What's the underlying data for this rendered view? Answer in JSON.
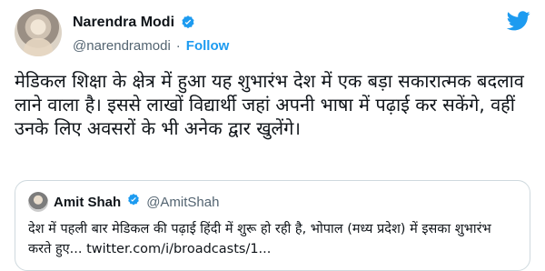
{
  "tweet": {
    "author_name": "Narendra Modi",
    "handle": "@narendramodi",
    "separator": "·",
    "follow_label": "Follow",
    "text": "मेडिकल शिक्षा के क्षेत्र में हुआ यह शुभारंभ देश में एक बड़ा सकारात्मक बदलाव लाने वाला है। इससे लाखों विद्यार्थी जहां अपनी भाषा में पढ़ाई कर सकेंगे, वहीं उनके लिए अवसरों के भी अनेक द्वार खुलेंगे।"
  },
  "quoted": {
    "author_name": "Amit Shah",
    "handle": "@AmitShah",
    "text": "देश में पहली बार मेडिकल की पढ़ाई हिंदी में शुरू हो रही है, भोपाल (मध्य प्रदेश) में इसका शुभारंभ करते हुए...",
    "link": "twitter.com/i/broadcasts/1..."
  },
  "colors": {
    "accent": "#1d9bf0",
    "muted": "#536471",
    "border": "#cfd9de"
  },
  "icons": {
    "verified": "verified-badge-icon",
    "logo": "twitter-bird-icon"
  }
}
